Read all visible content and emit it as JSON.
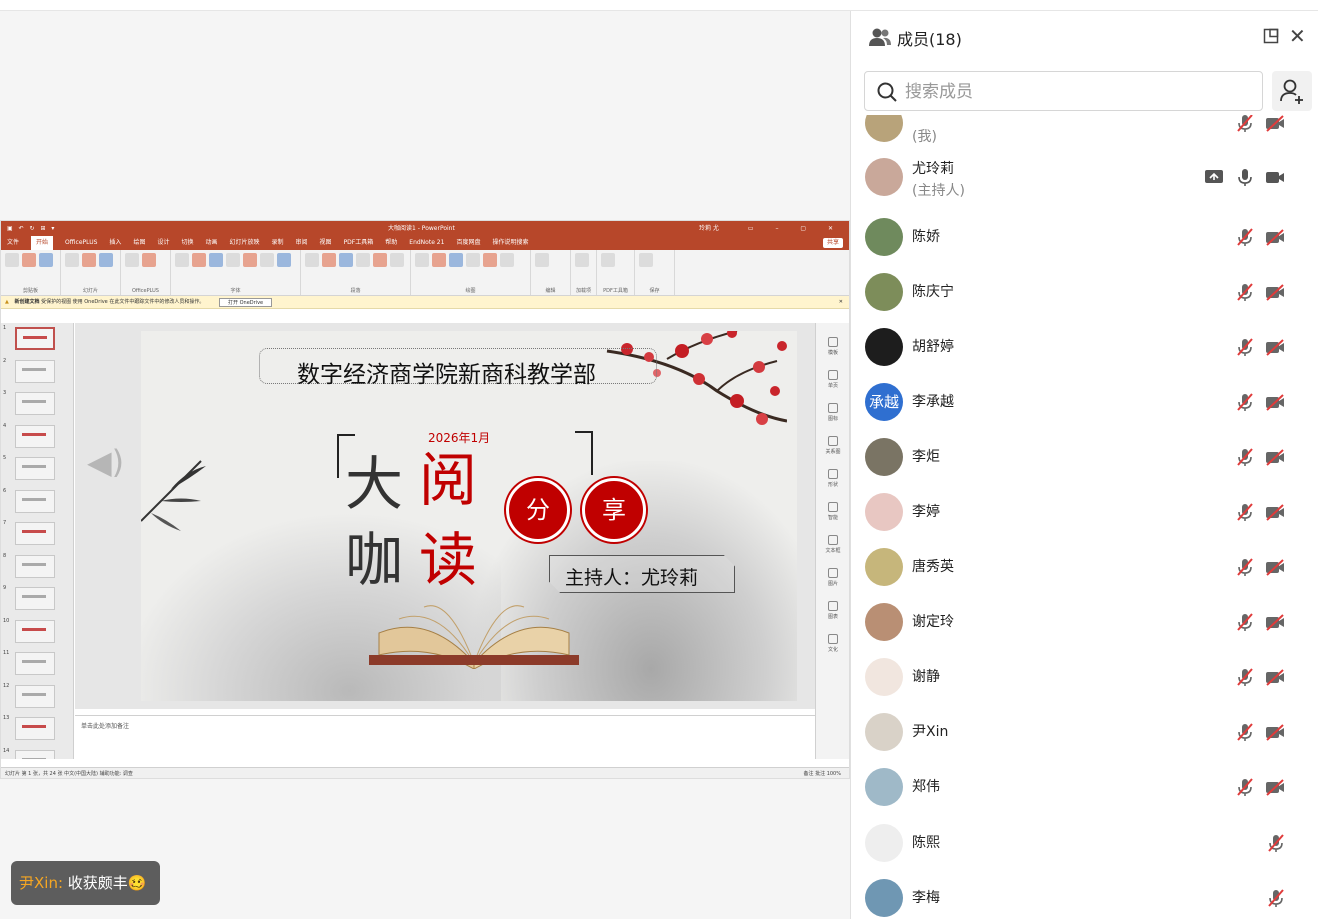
{
  "panel": {
    "title": "成员(18)",
    "search_placeholder": "搜索成员",
    "members": [
      {
        "name": "",
        "sub": "(我)",
        "avatar": "photo",
        "color": "#b8a37a",
        "mic": "muted",
        "cam": "off"
      },
      {
        "name": "尤玲莉",
        "sub": "(主持人)",
        "avatar": "photo",
        "color": "#c9a89a",
        "mic": "on",
        "cam": "on",
        "screen": true
      },
      {
        "name": "陈娇",
        "avatar": "photo",
        "color": "#6f8a5d",
        "mic": "muted",
        "cam": "off"
      },
      {
        "name": "陈庆宁",
        "avatar": "photo",
        "color": "#7d8d5a",
        "mic": "muted",
        "cam": "off"
      },
      {
        "name": "胡舒婷",
        "avatar": "photo",
        "color": "#1d1d1d",
        "mic": "muted",
        "cam": "off"
      },
      {
        "name": "李承越",
        "avatar": "text",
        "avatar_text": "承越",
        "color": "#2f6fd0",
        "mic": "muted",
        "cam": "off"
      },
      {
        "name": "李炬",
        "avatar": "photo",
        "color": "#7a7464",
        "mic": "muted",
        "cam": "off"
      },
      {
        "name": "李婷",
        "avatar": "photo",
        "color": "#e8c7c2",
        "mic": "muted",
        "cam": "off"
      },
      {
        "name": "唐秀英",
        "avatar": "photo",
        "color": "#c6b67b",
        "mic": "muted",
        "cam": "off"
      },
      {
        "name": "谢定玲",
        "avatar": "photo",
        "color": "#b98f74",
        "mic": "muted",
        "cam": "off"
      },
      {
        "name": "谢静",
        "avatar": "photo",
        "color": "#f1e6df",
        "mic": "muted",
        "cam": "off"
      },
      {
        "name": "尹Xin",
        "avatar": "photo",
        "color": "#d9d2c8",
        "mic": "muted",
        "cam": "off"
      },
      {
        "name": "郑伟",
        "avatar": "photo",
        "color": "#9fb9c8",
        "mic": "muted",
        "cam": "off"
      },
      {
        "name": "陈熙",
        "avatar": "photo",
        "color": "#eeeeee",
        "mic": "muted"
      },
      {
        "name": "李梅",
        "avatar": "photo",
        "color": "#6f97b3",
        "mic": "muted"
      }
    ]
  },
  "chat": {
    "sender": "尹Xin:",
    "message": "收获颇丰🥴"
  },
  "ppt": {
    "doc_title": "大咖阅读1 - PowerPoint",
    "user": "玲莉 尤",
    "tabs": [
      "文件",
      "开始",
      "OfficePLUS",
      "插入",
      "绘图",
      "设计",
      "切换",
      "动画",
      "幻灯片放映",
      "录制",
      "审阅",
      "视图",
      "PDF工具箱",
      "帮助",
      "EndNote 21",
      "百度网盘",
      "操作说明搜索"
    ],
    "active_tab": "开始",
    "share_btn": "共享",
    "ribbon_groups": [
      "剪贴板",
      "幻灯片",
      "OfficePLUS",
      "字体",
      "段落",
      "绘图",
      "编辑",
      "加载项",
      "PDF工具箱",
      "保存"
    ],
    "notice": "受保护的视图  使用 OneDrive 在此文件中跟踪文件中的修改人员和操作。",
    "notice_label": "新创建文档",
    "open_btn": "打开 OneDrive",
    "thumb_numbers": [
      "1",
      "2",
      "3",
      "4",
      "5",
      "6",
      "7",
      "8",
      "9",
      "10",
      "11",
      "12",
      "13",
      "14"
    ],
    "taskpane": [
      "模板",
      "单页",
      "图标",
      "关系图",
      "形状",
      "智能",
      "文本框",
      "图片",
      "图表",
      "文化"
    ],
    "notes_placeholder": "单击此处添加备注",
    "status_left": "幻灯片 第 1 张，共 24 张    中文(中国大陆)    辅助功能: 调查",
    "status_right": "备注  批注     100%",
    "slide": {
      "header": "数字经济商学院新商科教学部",
      "date": "2026年1月",
      "char1": "大",
      "char2": "阅",
      "char3": "咖",
      "char4": "读",
      "circle1": "分",
      "circle2": "享",
      "host": "主持人：尤玲莉"
    }
  }
}
